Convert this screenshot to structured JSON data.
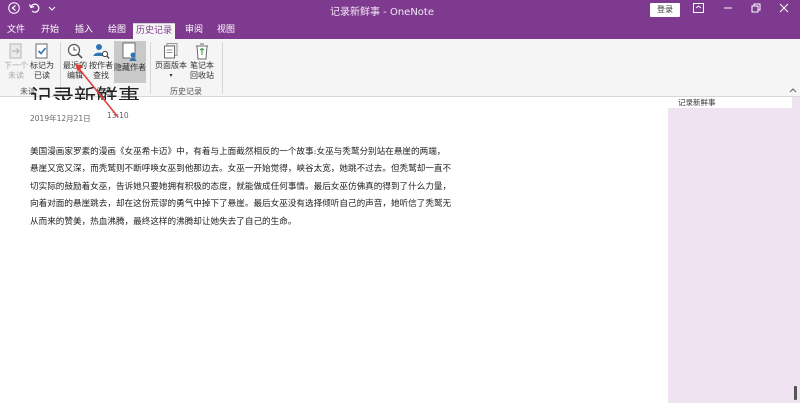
{
  "window": {
    "title": "记录新鲜事 - OneNote",
    "login_label": "登录"
  },
  "tabs": [
    {
      "label": "文件"
    },
    {
      "label": "开始"
    },
    {
      "label": "插入"
    },
    {
      "label": "绘图"
    },
    {
      "label": "历史记录"
    },
    {
      "label": "审阅"
    },
    {
      "label": "视图"
    }
  ],
  "active_tab": "历史记录",
  "ribbon": {
    "unread_group": {
      "label": "未读",
      "next_unread": [
        "下一个",
        "未读"
      ],
      "mark_as_read": [
        "标记为",
        "已读"
      ]
    },
    "authors_group": {
      "label": "作者",
      "recent_edits": [
        "最近的",
        "编辑"
      ],
      "find_by_author": [
        "按作者",
        "查找"
      ],
      "hide_authors": "隐藏作者"
    },
    "history_group": {
      "label": "历史记录",
      "page_versions": "页面版本",
      "notebook_recycle_bin": [
        "笔记本",
        "回收站"
      ]
    }
  },
  "page": {
    "title": "记录新鲜事",
    "date": "2019年12月21日",
    "time": "13:10",
    "paragraphs": [
      "美国漫画家罗素的漫画《女巫希卡迈》中，有着与上面截然相反的一个故事:女巫与秃鹫分别站在悬崖的两端，",
      "悬崖又宽又深，而秃鹫则不断呼唤女巫到他那边去。女巫一开始觉得，峡谷太宽，她跳不过去。但秃鹫却一直不",
      "切实际的鼓励着女巫，告诉她只要她拥有积极的态度，就能做成任何事情。最后女巫仿佛真的得到了什么力量，",
      "向着对面的悬崖跳去，却在这份荒谬的勇气中掉下了悬崖。最后女巫没有选择倾听自己的声音，她听信了秃鹫无",
      "从而来的赞美，热血沸腾，最终这样的沸腾却让她失去了自己的生命。"
    ]
  },
  "right_pane": {
    "page_item": "记录新鲜事"
  },
  "colors": {
    "brand": "#7d3a8f",
    "ribbon_bg": "#f5f5f5",
    "pane_bg": "#efe3f2",
    "annotation": "#e23b3b"
  }
}
